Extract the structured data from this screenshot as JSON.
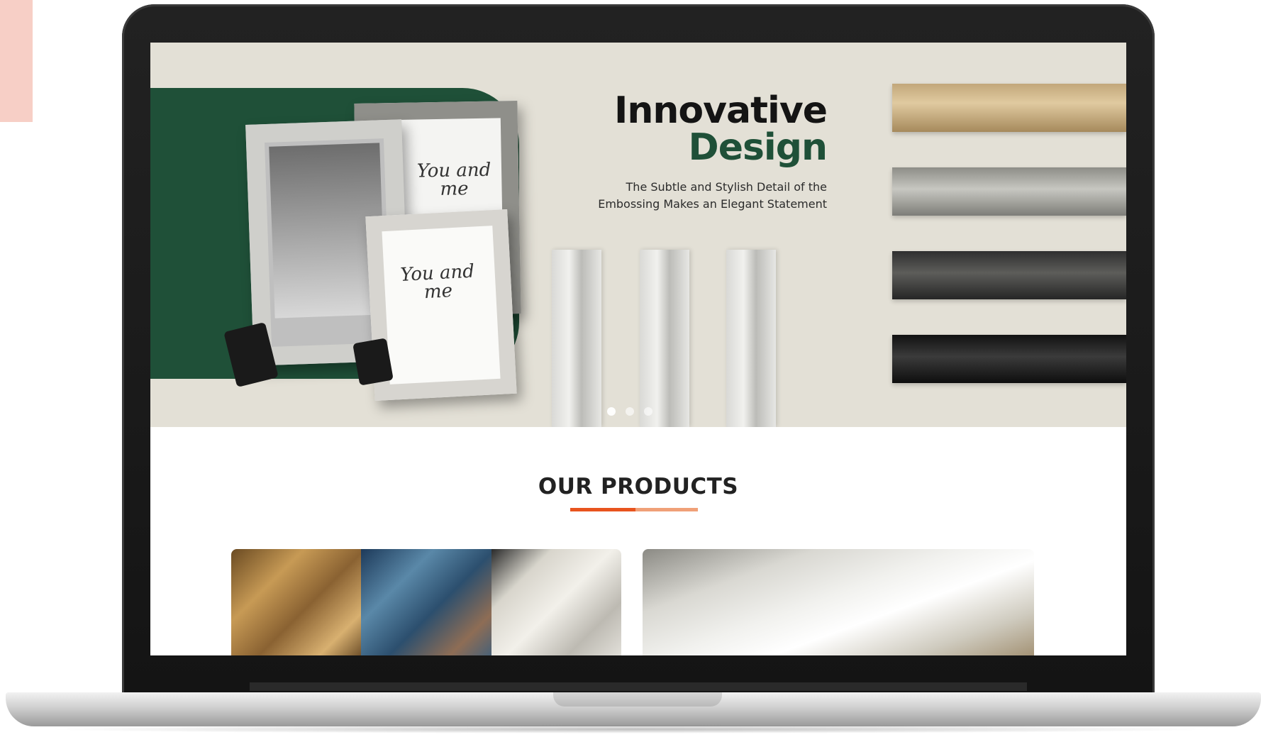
{
  "hero": {
    "title_line1": "Innovative",
    "title_line2": "Design",
    "subtitle_line1": "The Subtle and Stylish Detail of the",
    "subtitle_line2": "Embossing Makes an Elegant Statement",
    "frame_script_1": "You and me",
    "frame_script_2": "You and me",
    "carousel": {
      "slide_count": 3,
      "active_index": 0
    }
  },
  "products": {
    "heading": "OUR PRODUCTS"
  },
  "colors": {
    "hero_background": "#e3e0d6",
    "brand_green": "#1f5038",
    "accent_orange": "#e8541e",
    "accent_orange_light": "#f0a078",
    "heading_text": "#222222"
  },
  "icons": {
    "carousel_dot": "circle"
  }
}
